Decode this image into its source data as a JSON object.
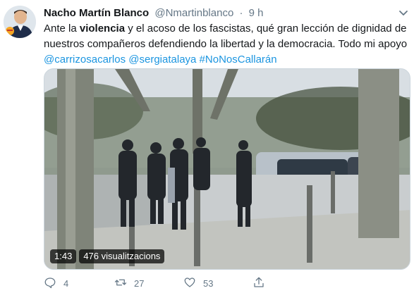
{
  "author": {
    "name": "Nacho Martín Blanco",
    "handle": "@Nmartinblanco",
    "separator": "·",
    "time": "9 h"
  },
  "tweet": {
    "text_1": "Ante la ",
    "text_bold": "violencia",
    "text_2": " y el acoso de los fascistas, qué gran lección de dignidad de nuestros compañeros defendiendo la libertad y la democracia. Todo mi apoyo ",
    "mention_1": "@carrizosacarlos",
    "space_1": " ",
    "mention_2": "@sergiatalaya",
    "space_2": " ",
    "hashtag": "#NoNosCallarán"
  },
  "video": {
    "duration": "1:43",
    "views": "476 visualitzacions"
  },
  "actions": {
    "replies": "4",
    "retweets": "27",
    "likes": "53"
  },
  "colors": {
    "link": "#1b95e0",
    "muted": "#657786"
  },
  "icons": [
    "avatar",
    "chevron-down-icon",
    "reply-icon",
    "retweet-icon",
    "like-icon",
    "share-icon"
  ]
}
